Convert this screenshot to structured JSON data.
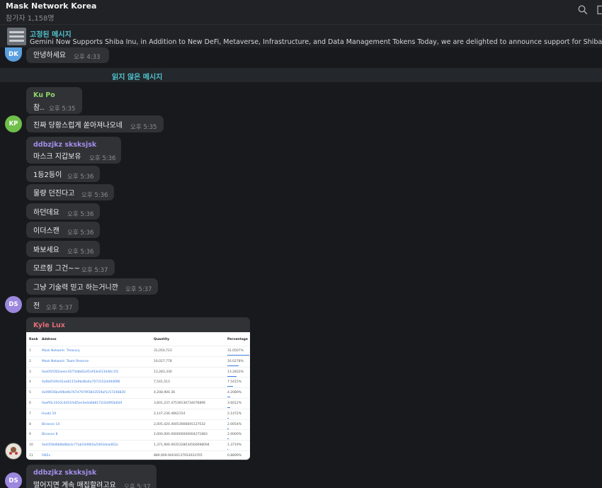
{
  "header": {
    "title": "Mask Network Korea",
    "members": "참가자 1,158명",
    "search_icon": "search-icon",
    "more_icon": "more-icon"
  },
  "pinned": {
    "title": "고정된 메시지",
    "text": "Gemini Now Supports Shiba Inu, in Addition to New DeFi, Metaverse, Infrastructure, and Data Management Tokens  Today, we are delighted to announce support for Shiba Inu (SHIB), a..."
  },
  "unread_label": "읽지 않은 메시지",
  "avatars": {
    "dk": "DK",
    "kp": "KP",
    "ds1": "DS",
    "ds2": "DS"
  },
  "messages": {
    "m0": {
      "text": "안녕하세요",
      "time": "오후 4:33"
    },
    "m1": {
      "name": "Ku Po",
      "text": "참..",
      "time": "오후 5:35"
    },
    "m2": {
      "text": "진짜 당황스럽게 쏟아져나오네",
      "time": "오후 5:35"
    },
    "m3": {
      "name": "ddbzjkz sksksjsk",
      "text": "마스크 지갑보유",
      "time": "오후 5:36"
    },
    "m4": {
      "text": "1등2등이",
      "time": "오후 5:36"
    },
    "m5": {
      "text": "물량 던진다고",
      "time": "오후 5:36"
    },
    "m6": {
      "text": "하던데요",
      "time": "오후 5:36"
    },
    "m7": {
      "text": "이더스캔",
      "time": "오후 5:36"
    },
    "m8": {
      "text": "봐보세요",
      "time": "오후 5:36"
    },
    "m9": {
      "text": "모르쥥 그건~~",
      "time": "오후 5:37"
    },
    "m10": {
      "text": "그냥 기술력 믿고 하는거니깐",
      "time": "오후 5:37"
    },
    "m11": {
      "text": "전",
      "time": "오후 5:37"
    },
    "m12": {
      "name": "Kyle Lux"
    },
    "m13": {
      "name": "ddbzjkz sksksjsk",
      "text": "떨어지면 계속 매집할려고요",
      "time": "오후 5:37"
    }
  },
  "colors": {
    "accent": "#4fc3d0",
    "ku_po": "#8fd36a",
    "ddbz": "#a48ee8",
    "kyle": "#e26d76",
    "dk_avatar": "#5aa0e0",
    "kp_avatar": "#6fbf4a",
    "ds_avatar": "#9b87dd"
  },
  "holders_table": {
    "headers": [
      "Rank",
      "Address",
      "Quantity",
      "Percentage"
    ],
    "rows": [
      {
        "rank": "1",
        "address": "Mask Network: Treasury",
        "quantity": "31,050,723",
        "pct": "31.0507%",
        "share": 0.3105
      },
      {
        "rank": "2",
        "address": "Mask Network: Team Reserve",
        "quantity": "16,027,778",
        "pct": "16.0278%",
        "share": 0.1603
      },
      {
        "rank": "3",
        "address": "0xe05f1f02aeec41f7d4b82af1ef43e013d40c1f3",
        "quantity": "13,283,330",
        "pct": "13.2833%",
        "share": 0.1328
      },
      {
        "rank": "4",
        "address": "0x6b0549c91ae6115e0bd8a4a7073152d49d096",
        "quantity": "7,541,513",
        "pct": "7.5415%",
        "share": 0.0754
      },
      {
        "rank": "5",
        "address": "0x09656bc6f8a9b767d7979f3843559af1c57248830",
        "quantity": "4,208,900.36",
        "pct": "4.2089%",
        "share": 0.0421
      },
      {
        "rank": "6",
        "address": "0xeff4c1010c4d51fe65ee3e0a6b9172d3d9f2b6d4",
        "quantity": "3,601,237.47539130734076896",
        "pct": "3.6012%",
        "share": 0.036
      },
      {
        "rank": "7",
        "address": "Huobi 10",
        "quantity": "2,147,236.4662154",
        "pct": "2.1472%",
        "share": 0.0215
      },
      {
        "rank": "8",
        "address": "Binance 14",
        "quantity": "2,005,420.40453666845127032",
        "pct": "2.0054%",
        "share": 0.0201
      },
      {
        "rank": "9",
        "address": "Binance 8",
        "quantity": "2,000,000.000000000004271883",
        "pct": "2.0000%",
        "share": 0.02
      },
      {
        "rank": "10",
        "address": "0xd358d6b6b8bb3c77ab10d9b5a5493dead62a",
        "quantity": "1,371,906.0635328034560098094",
        "pct": "1.3719%",
        "share": 0.0137
      },
      {
        "rank": "11",
        "address": "OKEx",
        "quantity": "889,909.94030137933024765",
        "pct": "0.8899%",
        "share": 0.0089
      }
    ]
  }
}
